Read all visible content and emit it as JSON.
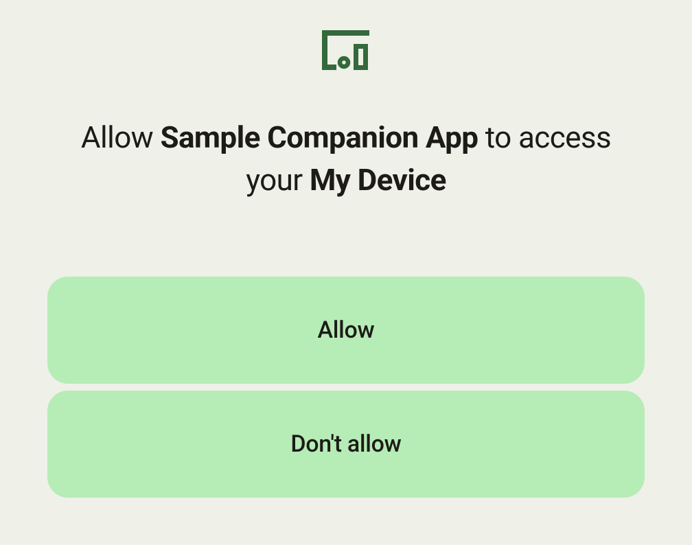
{
  "dialog": {
    "title_parts": {
      "prefix": "Allow ",
      "app_name": "Sample Companion App",
      "middle": " to access your ",
      "device_name": "My Device"
    },
    "buttons": {
      "allow": "Allow",
      "deny": "Don't allow"
    }
  },
  "colors": {
    "background": "#eff0e8",
    "button_bg": "#b6ecb6",
    "text": "#1c1b17",
    "icon": "#34693b"
  }
}
